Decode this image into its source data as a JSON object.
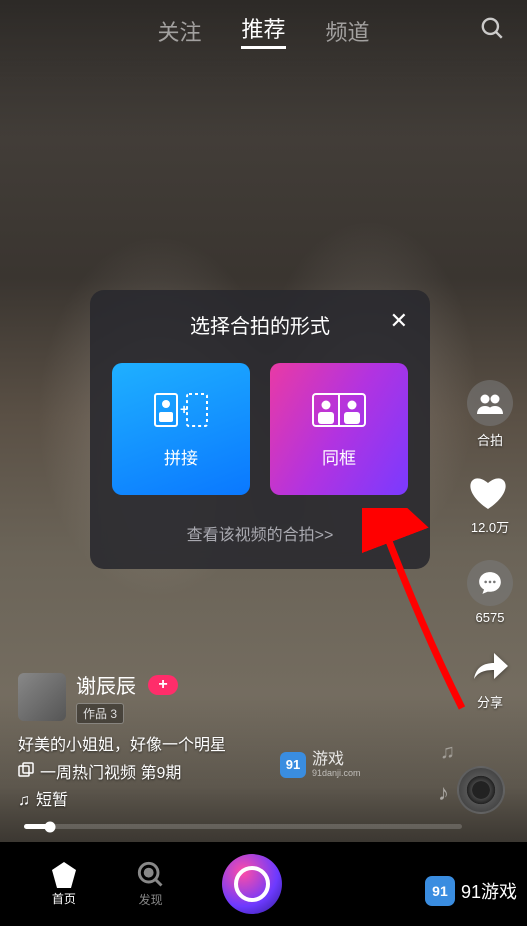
{
  "nav": {
    "tabs": {
      "follow": "关注",
      "recommend": "推荐",
      "channel": "频道"
    }
  },
  "rail": {
    "hepai": "合拍",
    "like_count": "12.0万",
    "comment_count": "6575",
    "share": "分享"
  },
  "author": {
    "name": "谢辰辰",
    "works_label": "作品 3"
  },
  "desc": {
    "caption": "好美的小姐姐，好像一个明星",
    "hot_video": "一周热门视频 第9期",
    "music": "短暂"
  },
  "modal": {
    "title": "选择合拍的形式",
    "option_pinjie": "拼接",
    "option_tongkuang": "同框",
    "view_link": "查看该视频的合拍>>"
  },
  "bottomnav": {
    "home": "首页",
    "discover": "发现"
  },
  "watermark": {
    "badge": "91",
    "text_small": "游戏",
    "subtext_small": "91danji.com",
    "text_big": "91游戏"
  }
}
